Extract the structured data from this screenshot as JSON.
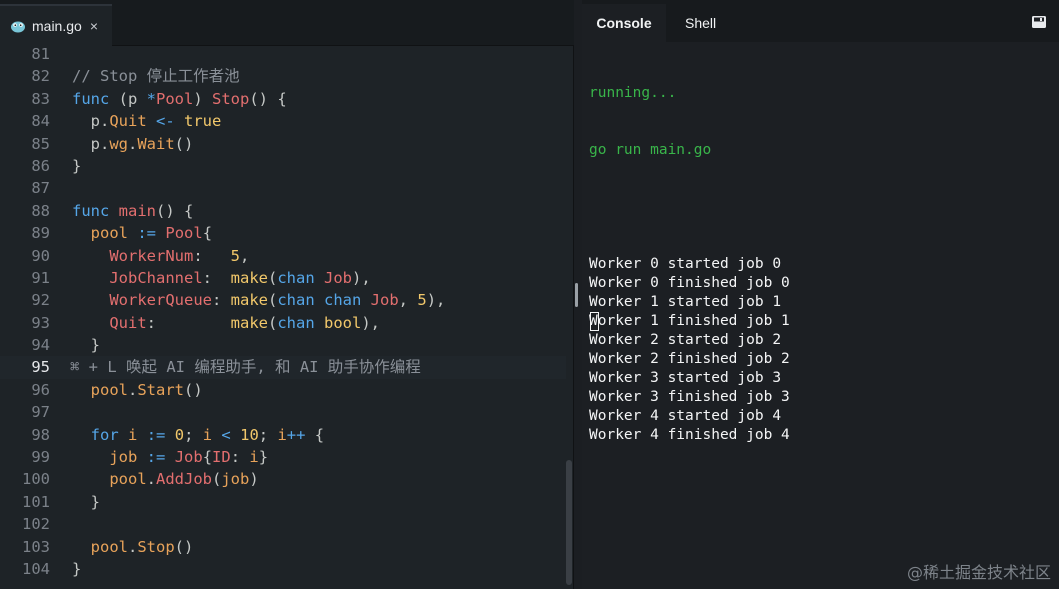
{
  "editor": {
    "tab_label": "main.go",
    "close_glyph": "×",
    "lines": [
      {
        "no": "81",
        "tokens": []
      },
      {
        "no": "82",
        "tokens": [
          [
            "c",
            "// Stop 停止工作者池"
          ]
        ]
      },
      {
        "no": "83",
        "tokens": [
          [
            "k",
            "func"
          ],
          [
            "p",
            " ("
          ],
          [
            "p",
            "p "
          ],
          [
            "k",
            "*"
          ],
          [
            "f",
            "Pool"
          ],
          [
            "p",
            ") "
          ],
          [
            "f",
            "Stop"
          ],
          [
            "p",
            "() {"
          ]
        ]
      },
      {
        "no": "84",
        "tokens": [
          [
            "p",
            "  p."
          ],
          [
            "y",
            "Quit"
          ],
          [
            "p",
            " "
          ],
          [
            "k",
            "<-"
          ],
          [
            "p",
            " "
          ],
          [
            "n",
            "true"
          ]
        ]
      },
      {
        "no": "85",
        "tokens": [
          [
            "p",
            "  p."
          ],
          [
            "y",
            "wg"
          ],
          [
            "p",
            "."
          ],
          [
            "y",
            "Wait"
          ],
          [
            "p",
            "()"
          ]
        ]
      },
      {
        "no": "86",
        "tokens": [
          [
            "p",
            "}"
          ]
        ]
      },
      {
        "no": "87",
        "tokens": []
      },
      {
        "no": "88",
        "tokens": [
          [
            "k",
            "func"
          ],
          [
            "p",
            " "
          ],
          [
            "f",
            "main"
          ],
          [
            "p",
            "() {"
          ]
        ]
      },
      {
        "no": "89",
        "tokens": [
          [
            "p",
            "  "
          ],
          [
            "y",
            "pool"
          ],
          [
            "p",
            " "
          ],
          [
            "k",
            ":="
          ],
          [
            "p",
            " "
          ],
          [
            "f",
            "Pool"
          ],
          [
            "p",
            "{"
          ]
        ]
      },
      {
        "no": "90",
        "tokens": [
          [
            "p",
            "    "
          ],
          [
            "f",
            "WorkerNum"
          ],
          [
            "p",
            ":   "
          ],
          [
            "n",
            "5"
          ],
          [
            "p",
            ","
          ]
        ]
      },
      {
        "no": "91",
        "tokens": [
          [
            "p",
            "    "
          ],
          [
            "f",
            "JobChannel"
          ],
          [
            "p",
            ":  "
          ],
          [
            "n",
            "make"
          ],
          [
            "p",
            "("
          ],
          [
            "k",
            "chan"
          ],
          [
            "p",
            " "
          ],
          [
            "f",
            "Job"
          ],
          [
            "p",
            "),"
          ]
        ]
      },
      {
        "no": "92",
        "tokens": [
          [
            "p",
            "    "
          ],
          [
            "f",
            "WorkerQueue"
          ],
          [
            "p",
            ": "
          ],
          [
            "n",
            "make"
          ],
          [
            "p",
            "("
          ],
          [
            "k",
            "chan"
          ],
          [
            "p",
            " "
          ],
          [
            "k",
            "chan"
          ],
          [
            "p",
            " "
          ],
          [
            "f",
            "Job"
          ],
          [
            "p",
            ", "
          ],
          [
            "n",
            "5"
          ],
          [
            "p",
            "),"
          ]
        ]
      },
      {
        "no": "93",
        "tokens": [
          [
            "p",
            "    "
          ],
          [
            "f",
            "Quit"
          ],
          [
            "p",
            ":        "
          ],
          [
            "n",
            "make"
          ],
          [
            "p",
            "("
          ],
          [
            "k",
            "chan"
          ],
          [
            "p",
            " "
          ],
          [
            "n",
            "bool"
          ],
          [
            "p",
            "),"
          ]
        ]
      },
      {
        "no": "94",
        "tokens": [
          [
            "p",
            "  }"
          ]
        ]
      },
      {
        "no": "95",
        "active": true,
        "tokens": [
          [
            "c",
            "⌘ + L 唤起 AI 编程助手, 和 AI 助手协作编程"
          ]
        ]
      },
      {
        "no": "96",
        "tokens": [
          [
            "p",
            "  "
          ],
          [
            "y",
            "pool"
          ],
          [
            "p",
            "."
          ],
          [
            "y",
            "Start"
          ],
          [
            "p",
            "()"
          ]
        ]
      },
      {
        "no": "97",
        "tokens": []
      },
      {
        "no": "98",
        "tokens": [
          [
            "p",
            "  "
          ],
          [
            "k",
            "for"
          ],
          [
            "p",
            " "
          ],
          [
            "y",
            "i"
          ],
          [
            "p",
            " "
          ],
          [
            "k",
            ":="
          ],
          [
            "p",
            " "
          ],
          [
            "n",
            "0"
          ],
          [
            "p",
            "; "
          ],
          [
            "y",
            "i"
          ],
          [
            "p",
            " "
          ],
          [
            "k",
            "<"
          ],
          [
            "p",
            " "
          ],
          [
            "n",
            "10"
          ],
          [
            "p",
            "; "
          ],
          [
            "y",
            "i"
          ],
          [
            "k",
            "++"
          ],
          [
            "p",
            " {"
          ]
        ]
      },
      {
        "no": "99",
        "tokens": [
          [
            "p",
            "    "
          ],
          [
            "y",
            "job"
          ],
          [
            "p",
            " "
          ],
          [
            "k",
            ":="
          ],
          [
            "p",
            " "
          ],
          [
            "f",
            "Job"
          ],
          [
            "p",
            "{"
          ],
          [
            "f",
            "ID"
          ],
          [
            "p",
            ": "
          ],
          [
            "y",
            "i"
          ],
          [
            "p",
            "}"
          ]
        ]
      },
      {
        "no": "100",
        "tokens": [
          [
            "p",
            "    "
          ],
          [
            "y",
            "pool"
          ],
          [
            "p",
            "."
          ],
          [
            "f",
            "AddJob"
          ],
          [
            "p",
            "("
          ],
          [
            "y",
            "job"
          ],
          [
            "p",
            ")"
          ]
        ]
      },
      {
        "no": "101",
        "tokens": [
          [
            "p",
            "  }"
          ]
        ]
      },
      {
        "no": "102",
        "tokens": []
      },
      {
        "no": "103",
        "tokens": [
          [
            "p",
            "  "
          ],
          [
            "y",
            "pool"
          ],
          [
            "p",
            "."
          ],
          [
            "y",
            "Stop"
          ],
          [
            "p",
            "()"
          ]
        ]
      },
      {
        "no": "104",
        "tokens": [
          [
            "p",
            "}"
          ]
        ]
      }
    ]
  },
  "console": {
    "tabs": [
      "Console",
      "Shell"
    ],
    "status_lines": [
      "running...",
      "go run main.go"
    ],
    "output_lines": [
      "Worker 0 started job 0",
      "Worker 0 finished job 0",
      "Worker 1 started job 1",
      "Worker 1 finished job 1",
      "Worker 2 started job 2",
      "Worker 2 finished job 2",
      "Worker 3 started job 3",
      "Worker 3 finished job 3",
      "Worker 4 started job 4",
      "Worker 4 finished job 4"
    ]
  },
  "watermark": "@稀土掘金技术社区",
  "colors": {
    "keyword": "#55a6e8",
    "function": "#e36f6f",
    "number": "#f2c86b",
    "comment": "#8a9098",
    "field": "#e8a35a",
    "status_green": "#39b54a"
  },
  "icons": {
    "tab_icon": "go-gopher-icon",
    "console_action": "save-icon"
  }
}
